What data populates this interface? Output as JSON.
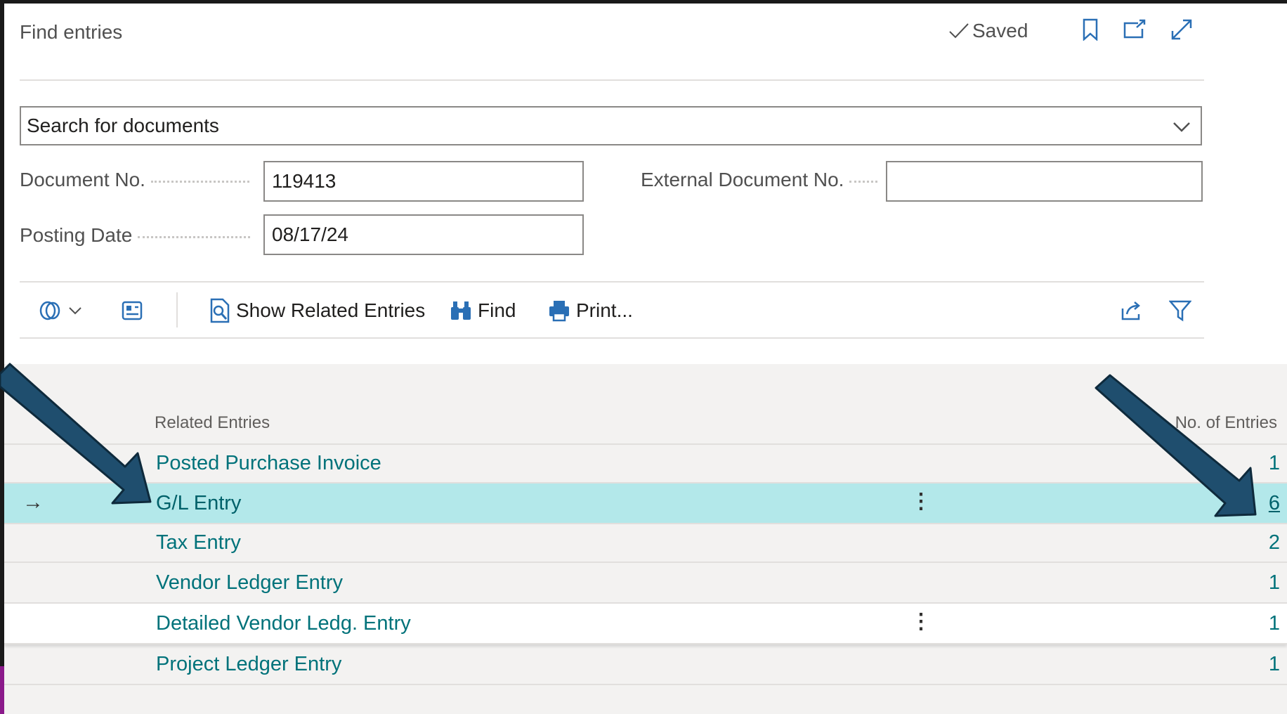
{
  "header": {
    "title": "Find entries",
    "saved_label": "Saved",
    "icons": [
      "bookmark-icon",
      "open-new-window-icon",
      "expand-icon"
    ]
  },
  "search": {
    "dropdown_value": "Search for documents"
  },
  "fields": {
    "document_no_label": "Document No.",
    "document_no_value": "119413",
    "external_document_no_label": "External Document No.",
    "external_document_no_value": "",
    "posting_date_label": "Posting Date",
    "posting_date_value": "08/17/24"
  },
  "toolbar": {
    "show_related_entries_label": "Show Related Entries",
    "find_label": "Find",
    "print_label": "Print..."
  },
  "grid": {
    "column_related": "Related Entries",
    "column_count": "No. of Entries",
    "rows": [
      {
        "name": "Posted Purchase Invoice",
        "count": "1"
      },
      {
        "name": "G/L Entry",
        "count": "6"
      },
      {
        "name": "Tax Entry",
        "count": "2"
      },
      {
        "name": "Vendor Ledger Entry",
        "count": "1"
      },
      {
        "name": "Detailed Vendor Ledg. Entry",
        "count": "1"
      },
      {
        "name": "Project Ledger Entry",
        "count": "1"
      }
    ]
  },
  "colors": {
    "selected_row": "#b3e8ea",
    "link": "#00727a",
    "annotation_arrow": "#1f4e6e"
  }
}
